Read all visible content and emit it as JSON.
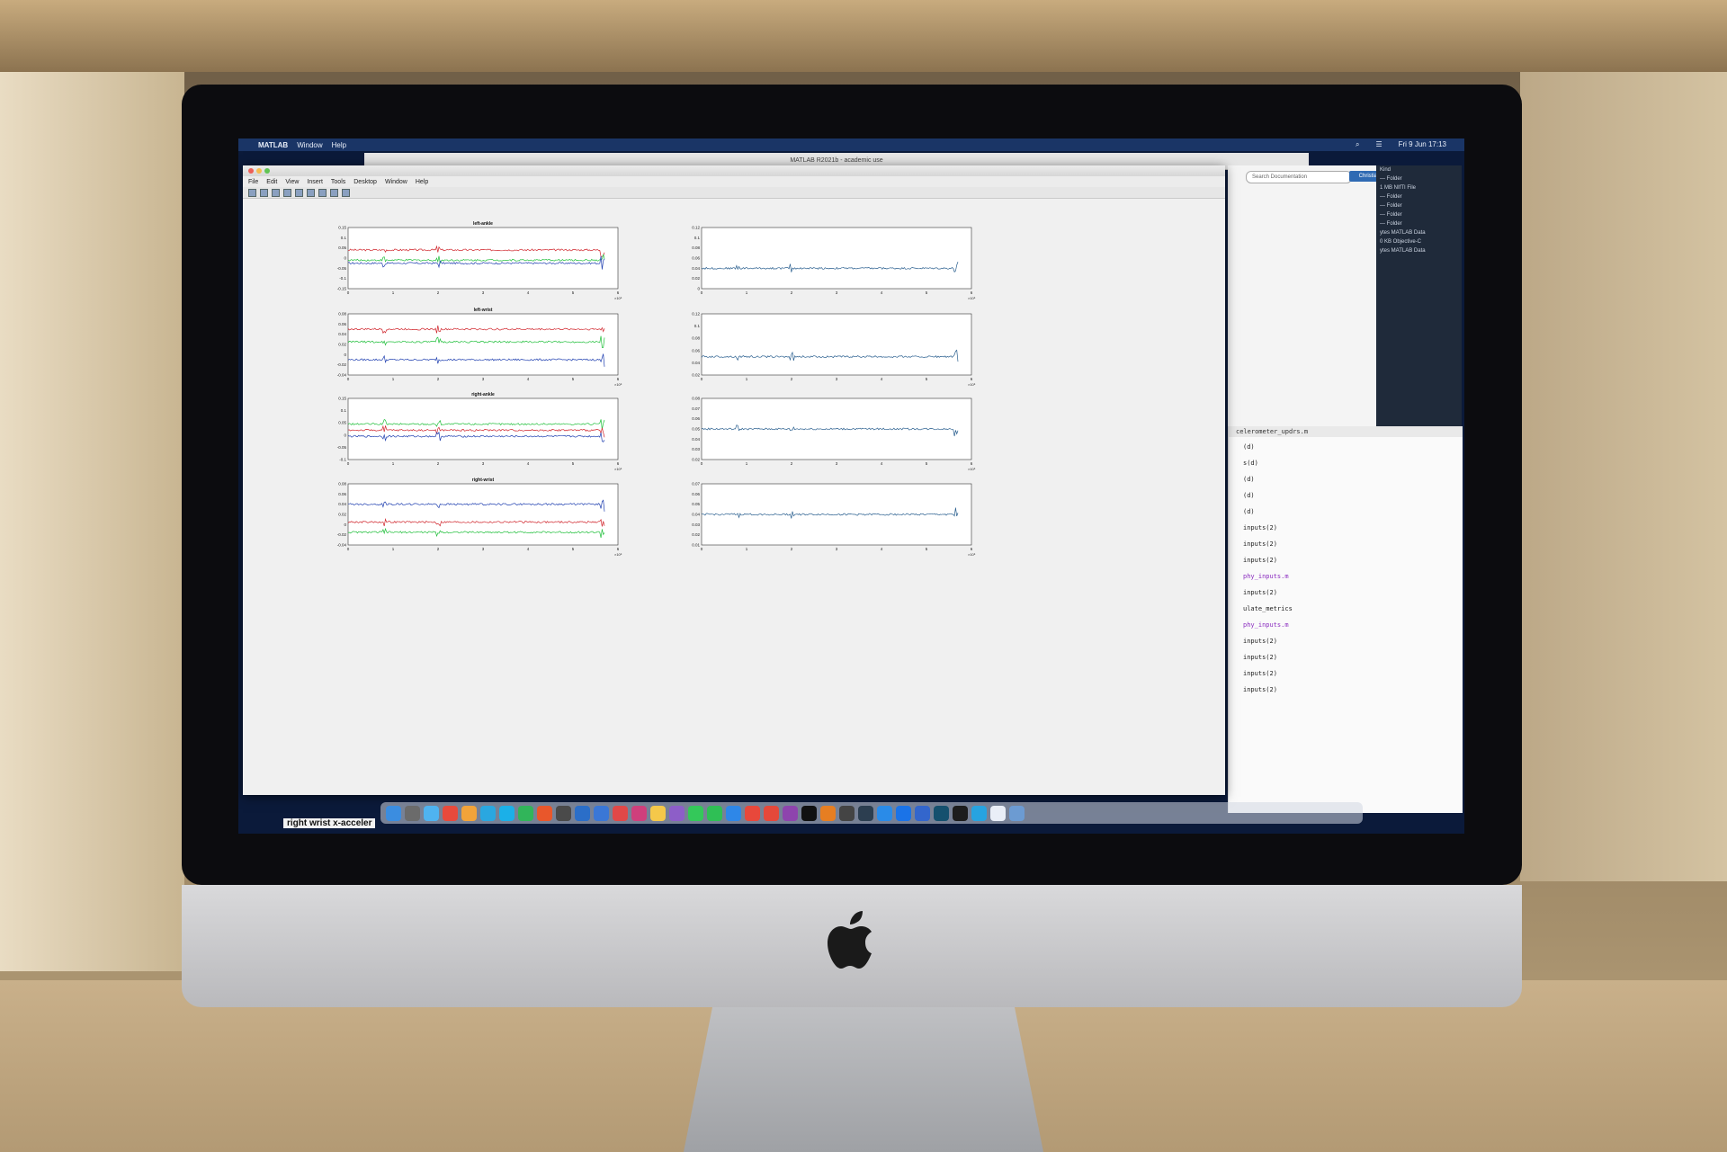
{
  "menubar": {
    "app": "MATLAB",
    "items": [
      "Window",
      "Help"
    ],
    "datetime": "Fri 9 Jun  17:13"
  },
  "matlab_main": {
    "title": "MATLAB R2021b - academic use",
    "search_placeholder": "Search Documentation",
    "user": "Christian"
  },
  "file_browser": {
    "header": "Kind",
    "rows": [
      "— Folder",
      "1 MB  NIfTI File",
      "— Folder",
      "— Folder",
      "— Folder",
      "— Folder",
      "ytes  MATLAB Data",
      "0 KB  Objective-C",
      "ytes  MATLAB Data"
    ]
  },
  "editor_tab": "celerometer_updrs.m",
  "code_lines": [
    "(d)",
    "s(d)",
    "(d)",
    "(d)",
    "(d)",
    "inputs(2)",
    "inputs(2)",
    "inputs(2)",
    "phy_inputs.m",
    "inputs(2)",
    "ulate_metrics",
    "phy_inputs.m",
    "inputs(2)",
    "inputs(2)",
    "inputs(2)",
    "inputs(2)"
  ],
  "figure": {
    "menu": [
      "File",
      "Edit",
      "View",
      "Insert",
      "Tools",
      "Desktop",
      "Window",
      "Help"
    ]
  },
  "caption": "right wrist x-acceler",
  "colors": {
    "red": "#d0242b",
    "green": "#1fbf3a",
    "blue": "#1f3fb0",
    "single": "#2a5f8f"
  },
  "chart_data": [
    {
      "type": "line",
      "title": "left-ankle",
      "xlim": [
        0,
        6
      ],
      "x_multiplier": "×10⁵",
      "ylim": [
        -0.15,
        0.15
      ],
      "yticks": [
        -0.15,
        -0.1,
        -0.05,
        0,
        0.05,
        0.1,
        0.15
      ],
      "xticks": [
        0,
        1,
        2,
        3,
        4,
        5,
        6
      ],
      "series": [
        {
          "color": "red",
          "level": 0.04
        },
        {
          "color": "green",
          "level": -0.01
        },
        {
          "color": "blue",
          "level": -0.025
        }
      ]
    },
    {
      "type": "line",
      "title": "",
      "xlim": [
        0,
        6
      ],
      "x_multiplier": "×10⁵",
      "ylim": [
        0,
        0.12
      ],
      "yticks": [
        0,
        0.02,
        0.04,
        0.06,
        0.08,
        0.1,
        0.12
      ],
      "xticks": [
        0,
        1,
        2,
        3,
        4,
        5,
        6
      ],
      "series": [
        {
          "color": "single",
          "level": 0.04
        }
      ]
    },
    {
      "type": "line",
      "title": "left-wrist",
      "xlim": [
        0,
        6
      ],
      "x_multiplier": "×10⁵",
      "ylim": [
        -0.04,
        0.08
      ],
      "yticks": [
        -0.04,
        -0.02,
        0,
        0.02,
        0.04,
        0.06,
        0.08
      ],
      "xticks": [
        0,
        1,
        2,
        3,
        4,
        5,
        6
      ],
      "series": [
        {
          "color": "red",
          "level": 0.05
        },
        {
          "color": "green",
          "level": 0.025
        },
        {
          "color": "blue",
          "level": -0.01
        }
      ]
    },
    {
      "type": "line",
      "title": "",
      "xlim": [
        0,
        6
      ],
      "x_multiplier": "×10⁵",
      "ylim": [
        0.02,
        0.12
      ],
      "yticks": [
        0.02,
        0.04,
        0.06,
        0.08,
        0.1,
        0.12
      ],
      "xticks": [
        0,
        1,
        2,
        3,
        4,
        5,
        6
      ],
      "series": [
        {
          "color": "single",
          "level": 0.05
        }
      ]
    },
    {
      "type": "line",
      "title": "right-ankle",
      "xlim": [
        0,
        6
      ],
      "x_multiplier": "×10⁵",
      "ylim": [
        -0.1,
        0.15
      ],
      "yticks": [
        -0.1,
        -0.05,
        0,
        0.05,
        0.1,
        0.15
      ],
      "xticks": [
        0,
        1,
        2,
        3,
        4,
        5,
        6
      ],
      "series": [
        {
          "color": "green",
          "level": 0.045
        },
        {
          "color": "red",
          "level": 0.02
        },
        {
          "color": "blue",
          "level": -0.005
        }
      ]
    },
    {
      "type": "line",
      "title": "",
      "xlim": [
        0,
        6
      ],
      "x_multiplier": "×10⁵",
      "ylim": [
        0.02,
        0.08
      ],
      "yticks": [
        0.02,
        0.03,
        0.04,
        0.05,
        0.06,
        0.07,
        0.08
      ],
      "xticks": [
        0,
        1,
        2,
        3,
        4,
        5,
        6
      ],
      "series": [
        {
          "color": "single",
          "level": 0.05
        }
      ]
    },
    {
      "type": "line",
      "title": "right-wrist",
      "xlim": [
        0,
        6
      ],
      "x_multiplier": "×10⁵",
      "ylim": [
        -0.04,
        0.08
      ],
      "yticks": [
        -0.04,
        -0.02,
        0,
        0.02,
        0.04,
        0.06,
        0.08
      ],
      "xticks": [
        0,
        1,
        2,
        3,
        4,
        5,
        6
      ],
      "series": [
        {
          "color": "blue",
          "level": 0.04
        },
        {
          "color": "red",
          "level": 0.005
        },
        {
          "color": "green",
          "level": -0.015
        }
      ]
    },
    {
      "type": "line",
      "title": "",
      "xlim": [
        0,
        6
      ],
      "x_multiplier": "×10⁵",
      "ylim": [
        0.01,
        0.07
      ],
      "yticks": [
        0.01,
        0.02,
        0.03,
        0.04,
        0.05,
        0.06,
        0.07
      ],
      "xticks": [
        0,
        1,
        2,
        3,
        4,
        5,
        6
      ],
      "series": [
        {
          "color": "single",
          "level": 0.04
        }
      ]
    }
  ]
}
